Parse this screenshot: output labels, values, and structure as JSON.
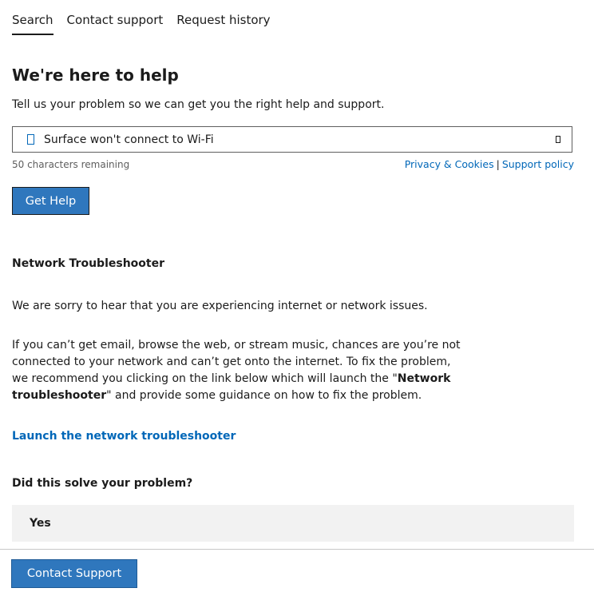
{
  "tabs": [
    {
      "label": "Search",
      "active": true
    },
    {
      "label": "Contact support",
      "active": false
    },
    {
      "label": "Request history",
      "active": false
    }
  ],
  "main": {
    "heading": "We're here to help",
    "subtext": "Tell us your problem so we can get you the right help and support.",
    "search": {
      "value": "Surface won't connect to Wi-Fi",
      "icon": "document-icon",
      "clear_icon": "clear-icon"
    },
    "char_remaining": "50 characters remaining",
    "privacy_link": "Privacy & Cookies",
    "link_separator": "|",
    "support_policy_link": "Support policy",
    "get_help_label": "Get Help"
  },
  "result": {
    "title": "Network Troubleshooter",
    "para1": "We are sorry to hear that you are experiencing internet or network issues.",
    "para2_start": "If you can’t get email, browse the web, or stream music, chances are you’re not connected to your network and can’t get onto the internet. To fix the problem, we recommend you clicking on the link below which will launch the \"",
    "para2_bold": "Network troubleshooter",
    "para2_end": "\" and provide some guidance on how to fix the problem.",
    "launch_link": "Launch the network troubleshooter",
    "question": "Did this solve your problem?",
    "yes_label": "Yes"
  },
  "footer": {
    "contact_support_label": "Contact Support"
  },
  "colors": {
    "accent": "#2f77bd",
    "link": "#0067b8",
    "option_bg": "#f2f2f2"
  }
}
